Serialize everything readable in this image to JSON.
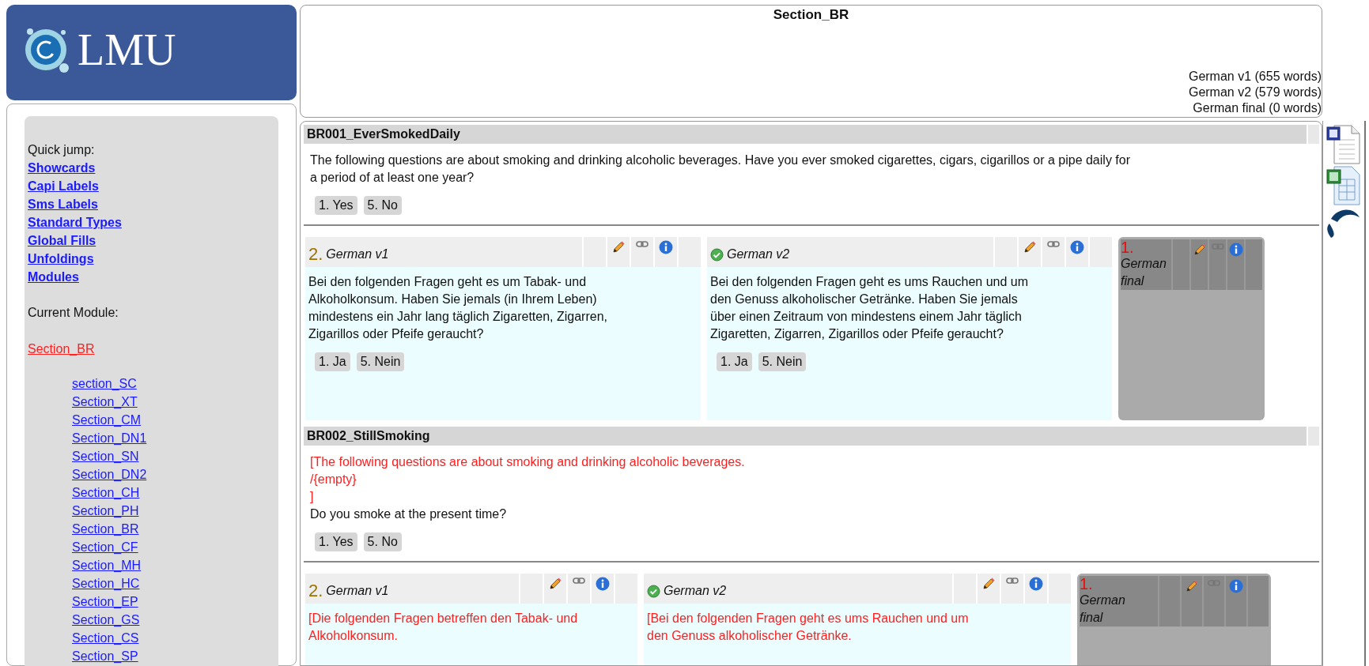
{
  "logo": {
    "text": "LMU"
  },
  "header": {
    "title": "Section_BR",
    "word_counts": [
      "German v1 (655 words)",
      "German v2 (579 words)",
      "German final (0 words)"
    ]
  },
  "sidebar": {
    "quick_jump_label": "Quick jump:",
    "links": [
      "Showcards",
      "Capi Labels",
      "Sms Labels",
      "Standard Types",
      "Global Fills",
      "Unfoldings",
      "Modules"
    ],
    "current_module_label": "Current Module:",
    "current_module": "Section_BR",
    "modules": [
      "section_SC",
      "Section_XT",
      "Section_CM",
      "Section_DN1",
      "Section_SN",
      "Section_DN2",
      "Section_CH",
      "Section_PH",
      "Section_BR",
      "Section_CF",
      "Section_MH",
      "Section_HC",
      "Section_EP",
      "Section_GS",
      "Section_CS",
      "Section_SP"
    ]
  },
  "questions": [
    {
      "id": "BR001_EverSmokedDaily",
      "lines": [
        {
          "kind": "plain",
          "text": "The following questions are about smoking and drinking alcoholic beverages. Have you ever smoked cigarettes, cigars, cigarillos or a pipe daily for a period of at least one year?"
        }
      ],
      "answers": [
        "1. Yes",
        "5. No"
      ],
      "translations": [
        {
          "kind": "version",
          "number": "2.",
          "label": "German v1",
          "approved": false,
          "lines": [
            {
              "kind": "plain",
              "text": "Bei den folgenden Fragen geht es um Tabak- und Alkoholkonsum. Haben Sie jemals (in Ihrem Leben) mindestens ein Jahr lang täglich Zigaretten, Zigarren, Zigarillos oder Pfeife geraucht?"
            }
          ],
          "answers": [
            "1. Ja",
            "5. Nein"
          ]
        },
        {
          "kind": "version",
          "label": "German v2",
          "approved": true,
          "lines": [
            {
              "kind": "plain",
              "text": "Bei den folgenden Fragen geht es ums Rauchen und um den Genuss alkoholischer Getränke. Haben Sie jemals über einen Zeitraum von mindestens einem Jahr täglich Zigaretten, Zigarren, Zigarillos oder Pfeife geraucht?"
            }
          ],
          "answers": [
            "1. Ja",
            "5. Nein"
          ]
        },
        {
          "kind": "final",
          "number": "1.",
          "label": "German final",
          "approved": false
        }
      ]
    },
    {
      "id": "BR002_StillSmoking",
      "lines": [
        {
          "kind": "fill",
          "text": "[The following questions are about smoking and drinking alcoholic beverages."
        },
        {
          "kind": "fill",
          "text": "/{empty}"
        },
        {
          "kind": "fill",
          "text": "]"
        },
        {
          "kind": "plain",
          "text": "Do you smoke at the present time?"
        }
      ],
      "answers": [
        "1. Yes",
        "5. No"
      ],
      "translations": [
        {
          "kind": "version",
          "number": "2.",
          "label": "German v1",
          "approved": false,
          "lines": [
            {
              "kind": "fill",
              "text": "[Die folgenden Fragen betreffen den Tabak- und Alkoholkonsum."
            }
          ]
        },
        {
          "kind": "version",
          "label": "German v2",
          "approved": true,
          "lines": [
            {
              "kind": "fill",
              "text": "[Bei den folgenden Fragen geht es ums Rauchen und um den Genuss alkoholischer Getränke."
            }
          ]
        },
        {
          "kind": "final",
          "number": "1.",
          "label": "German final",
          "approved": false
        }
      ]
    }
  ]
}
